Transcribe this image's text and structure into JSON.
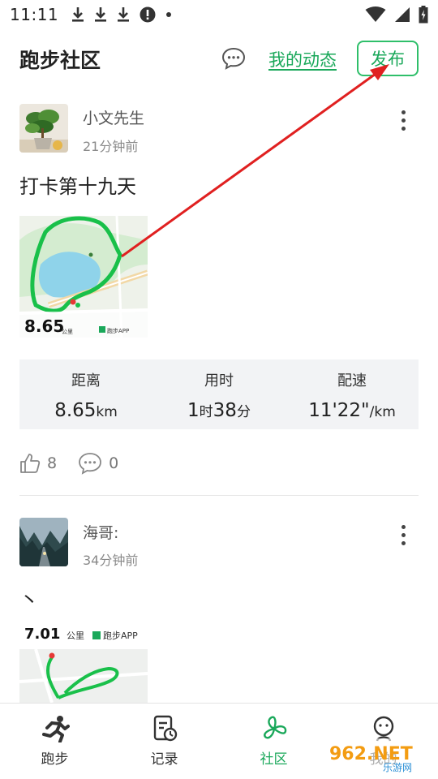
{
  "status_bar": {
    "time": "11:11"
  },
  "header": {
    "title": "跑步社区",
    "my_activity": "我的动态",
    "publish": "发布"
  },
  "posts": [
    {
      "name": "小文先生",
      "time": "21分钟前",
      "text": "打卡第十九天",
      "map_distance": "8.65",
      "map_unit": "公里",
      "map_brand": "跑步APP",
      "stats": [
        {
          "label": "距离",
          "value": "8.65",
          "unit": "km"
        },
        {
          "label": "用时",
          "value_h": "1",
          "unit_h": "时",
          "value_m": "38",
          "unit_m": "分"
        },
        {
          "label": "配速",
          "value": "11'22\"",
          "unit": "/km"
        }
      ],
      "likes": "8",
      "comments": "0"
    },
    {
      "name": "海哥:",
      "time": "34分钟前",
      "text": "丶",
      "map_distance": "7.01",
      "map_unit": "公里",
      "map_brand": "跑步APP"
    }
  ],
  "tabs": [
    {
      "label": "跑步",
      "icon": "runner-icon"
    },
    {
      "label": "记录",
      "icon": "record-icon"
    },
    {
      "label": "社区",
      "icon": "community-icon"
    },
    {
      "label": "我的",
      "icon": "profile-icon"
    }
  ],
  "watermark": "962.NET",
  "watermark_sub": "乐游网",
  "colors": {
    "accent": "#1aa85a",
    "arrow": "#e02020"
  }
}
